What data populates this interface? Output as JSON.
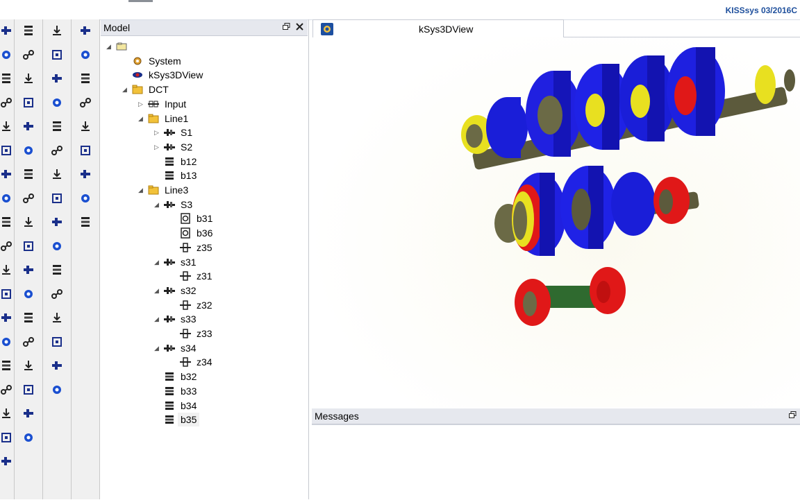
{
  "app": {
    "brand": "KISSsys 03/2016C"
  },
  "model_panel": {
    "title": "Model",
    "buttons": [
      "restore-icon",
      "close-icon"
    ],
    "tree": [
      {
        "label": "",
        "level": 0,
        "toggle": "open",
        "icon": "root-folder-icon"
      },
      {
        "label": "System",
        "level": 1,
        "toggle": "",
        "icon": "system-icon"
      },
      {
        "label": "kSys3DView",
        "level": 1,
        "toggle": "",
        "icon": "eye-icon"
      },
      {
        "label": "DCT",
        "level": 1,
        "toggle": "open",
        "icon": "folder-icon"
      },
      {
        "label": "Input",
        "level": 2,
        "toggle": "closed",
        "icon": "coupling-icon"
      },
      {
        "label": "Line1",
        "level": 2,
        "toggle": "open",
        "icon": "folder-icon"
      },
      {
        "label": "S1",
        "level": 3,
        "toggle": "closed",
        "icon": "shaft-icon"
      },
      {
        "label": "S2",
        "level": 3,
        "toggle": "closed",
        "icon": "shaft-icon"
      },
      {
        "label": "b12",
        "level": 3,
        "toggle": "",
        "icon": "bearing-icon"
      },
      {
        "label": "b13",
        "level": 3,
        "toggle": "",
        "icon": "bearing-icon"
      },
      {
        "label": "Line3",
        "level": 2,
        "toggle": "open",
        "icon": "folder-icon"
      },
      {
        "label": "S3",
        "level": 3,
        "toggle": "open",
        "icon": "shaft-icon"
      },
      {
        "label": "b31",
        "level": 4,
        "toggle": "",
        "icon": "rolling-bearing-icon"
      },
      {
        "label": "b36",
        "level": 4,
        "toggle": "",
        "icon": "rolling-bearing-icon"
      },
      {
        "label": "z35",
        "level": 4,
        "toggle": "",
        "icon": "gear-icon"
      },
      {
        "label": "s31",
        "level": 3,
        "toggle": "open",
        "icon": "shaft-icon"
      },
      {
        "label": "z31",
        "level": 4,
        "toggle": "",
        "icon": "gear-icon"
      },
      {
        "label": "s32",
        "level": 3,
        "toggle": "open",
        "icon": "shaft-icon"
      },
      {
        "label": "z32",
        "level": 4,
        "toggle": "",
        "icon": "gear-icon"
      },
      {
        "label": "s33",
        "level": 3,
        "toggle": "open",
        "icon": "shaft-icon"
      },
      {
        "label": "z33",
        "level": 4,
        "toggle": "",
        "icon": "gear-icon"
      },
      {
        "label": "s34",
        "level": 3,
        "toggle": "open",
        "icon": "shaft-icon"
      },
      {
        "label": "z34",
        "level": 4,
        "toggle": "",
        "icon": "gear-icon"
      },
      {
        "label": "b32",
        "level": 3,
        "toggle": "",
        "icon": "bearing-icon"
      },
      {
        "label": "b33",
        "level": 3,
        "toggle": "",
        "icon": "bearing-icon"
      },
      {
        "label": "b34",
        "level": 3,
        "toggle": "",
        "icon": "bearing-icon"
      },
      {
        "label": "b35",
        "level": 3,
        "toggle": "",
        "icon": "bearing-icon",
        "selected": true
      }
    ]
  },
  "view_tab": {
    "title": "kSys3DView",
    "icon": "3d-view-icon"
  },
  "messages_panel": {
    "title": "Messages",
    "buttons": [
      "restore-icon"
    ]
  },
  "colors": {
    "gear_blue": "#1a1ed8",
    "hub_yellow": "#e8e020",
    "shaft_olive": "#5c5a3c",
    "gear_red": "#e01818",
    "shaft_green": "#2f6a2f",
    "accent": "#1e4f9c"
  }
}
